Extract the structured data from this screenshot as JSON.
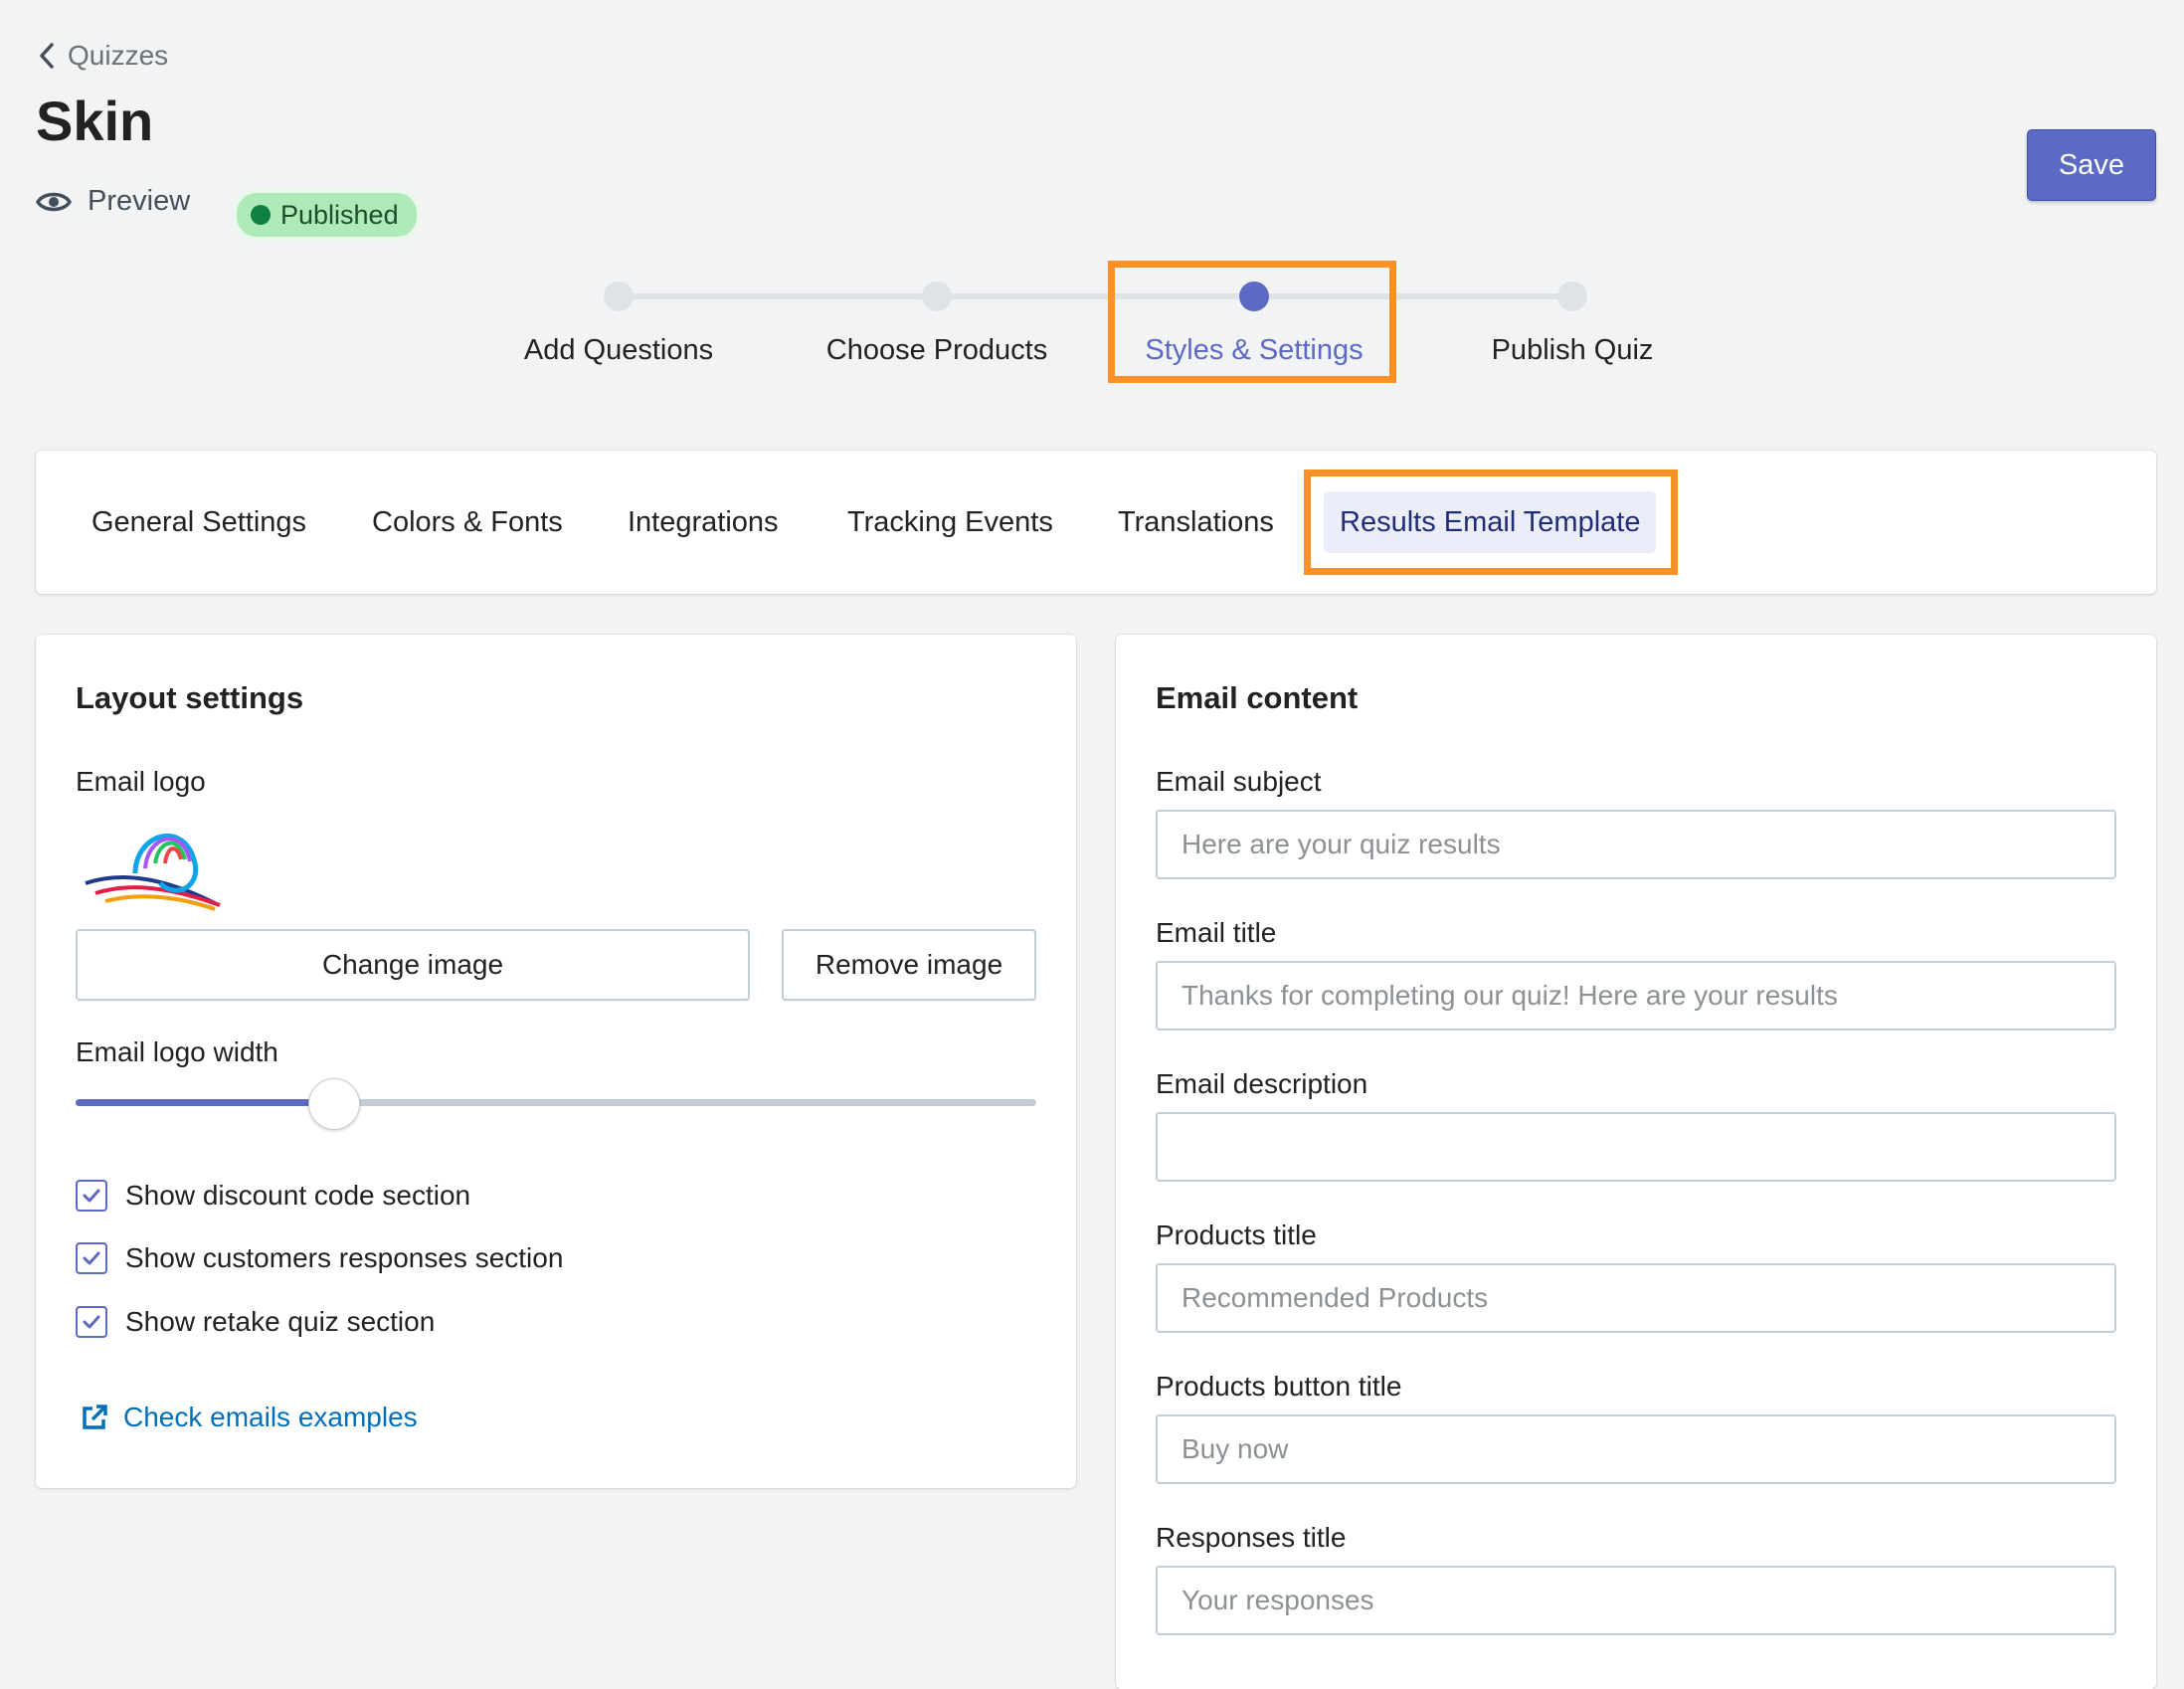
{
  "header": {
    "back_label": "Quizzes",
    "title": "Skin",
    "preview_label": "Preview",
    "status_badge": "Published",
    "save_label": "Save"
  },
  "stepper": {
    "steps": [
      {
        "label": "Add Questions",
        "active": false
      },
      {
        "label": "Choose Products",
        "active": false
      },
      {
        "label": "Styles & Settings",
        "active": true
      },
      {
        "label": "Publish Quiz",
        "active": false
      }
    ]
  },
  "tabs": [
    {
      "label": "General Settings",
      "active": false
    },
    {
      "label": "Colors & Fonts",
      "active": false
    },
    {
      "label": "Integrations",
      "active": false
    },
    {
      "label": "Tracking Events",
      "active": false
    },
    {
      "label": "Translations",
      "active": false
    },
    {
      "label": "Results Email Template",
      "active": true
    }
  ],
  "layout_settings": {
    "title": "Layout settings",
    "email_logo_label": "Email logo",
    "change_image_label": "Change image",
    "remove_image_label": "Remove image",
    "logo_width_label": "Email logo width",
    "logo_width_fraction": 0.27,
    "checkboxes": [
      {
        "label": "Show discount code section",
        "checked": true
      },
      {
        "label": "Show customers responses section",
        "checked": true
      },
      {
        "label": "Show retake quiz section",
        "checked": true
      }
    ],
    "check_examples_link": "Check emails examples"
  },
  "email_content": {
    "title": "Email content",
    "fields": [
      {
        "label": "Email subject",
        "placeholder": "Here are your quiz results",
        "value": ""
      },
      {
        "label": "Email title",
        "placeholder": "Thanks for completing our quiz! Here are your results",
        "value": ""
      },
      {
        "label": "Email description",
        "placeholder": "",
        "value": ""
      },
      {
        "label": "Products title",
        "placeholder": "Recommended Products",
        "value": ""
      },
      {
        "label": "Products button title",
        "placeholder": "Buy now",
        "value": ""
      },
      {
        "label": "Responses title",
        "placeholder": "Your responses",
        "value": ""
      }
    ]
  },
  "colors": {
    "accent": "#5c6ac4",
    "highlight_box": "#fd9026",
    "badge_bg": "#aee9b8",
    "link": "#006fbb"
  }
}
